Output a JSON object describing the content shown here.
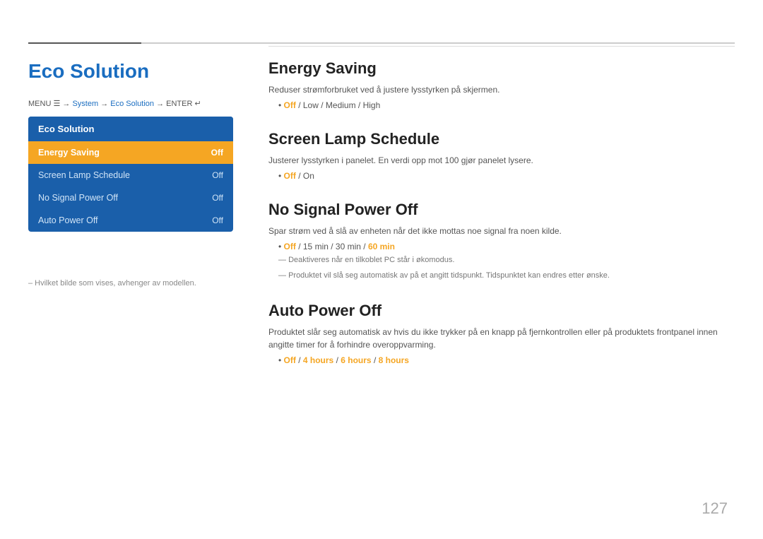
{
  "page": {
    "title": "Eco Solution",
    "page_number": "127"
  },
  "menu_path": {
    "prefix": "MENU",
    "icon": "☰",
    "arrow": "→",
    "system": "System",
    "arrow2": "→",
    "eco_solution": "Eco Solution",
    "arrow3": "→",
    "enter": "ENTER",
    "enter_icon": "↵"
  },
  "sidebar": {
    "header": "Eco Solution",
    "items": [
      {
        "label": "Energy Saving",
        "value": "Off",
        "active": true
      },
      {
        "label": "Screen Lamp Schedule",
        "value": "Off",
        "active": false
      },
      {
        "label": "No Signal Power Off",
        "value": "Off",
        "active": false
      },
      {
        "label": "Auto Power Off",
        "value": "Off",
        "active": false
      }
    ]
  },
  "footnote": "–  Hvilket bilde som vises, avhenger av modellen.",
  "sections": [
    {
      "id": "energy-saving",
      "title": "Energy Saving",
      "description": "Reduser strømforbruket ved å justere lysstyrken på skjermen.",
      "options_text": "Off / Low / Medium / High",
      "options_highlighted": [
        "Off"
      ],
      "notes": []
    },
    {
      "id": "screen-lamp-schedule",
      "title": "Screen Lamp Schedule",
      "description": "Justerer lysstyrken i panelet. En verdi opp mot 100 gjør panelet lysere.",
      "options_text": "Off / On",
      "options_highlighted": [
        "Off"
      ],
      "notes": []
    },
    {
      "id": "no-signal-power-off",
      "title": "No Signal Power Off",
      "description": "Spar strøm ved å slå av enheten når det ikke mottas noe signal fra noen kilde.",
      "options_text": "Off / 15 min / 30 min / 60 min",
      "options_highlighted": [
        "Off"
      ],
      "notes": [
        "Deaktiveres når en tilkoblet PC står i økomodus.",
        "Produktet vil slå seg automatisk av på et angitt tidspunkt. Tidspunktet kan endres etter ønske."
      ]
    },
    {
      "id": "auto-power-off",
      "title": "Auto Power Off",
      "description": "Produktet slår seg automatisk av hvis du ikke trykker på en knapp på fjernkontrollen eller på produktets frontpanel innen angitte timer for å forhindre overoppvarming.",
      "options_text": "Off / 4 hours / 6 hours / 8 hours",
      "options_highlighted": [
        "Off",
        "4 hours",
        "6 hours",
        "8 hours"
      ],
      "notes": []
    }
  ]
}
